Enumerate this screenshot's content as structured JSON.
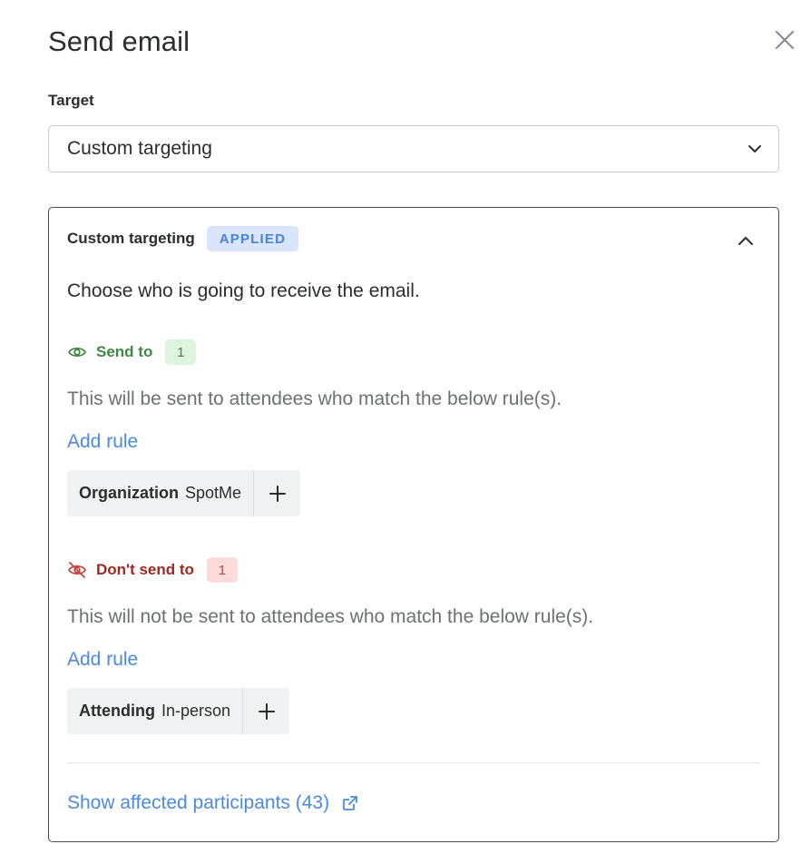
{
  "dialog": {
    "title": "Send email",
    "close_icon": "close-icon"
  },
  "target": {
    "label": "Target",
    "value": "Custom targeting"
  },
  "panel": {
    "title": "Custom targeting",
    "badge": "APPLIED",
    "intro": "Choose who is going to receive the email.",
    "send_to": {
      "label": "Send to",
      "count": "1",
      "description": "This will be sent to attendees who match the below rule(s).",
      "add_rule": "Add rule",
      "rule": {
        "key": "Organization",
        "value": "SpotMe"
      },
      "color": "#3f8a43"
    },
    "dont_send_to": {
      "label": "Don't send to",
      "count": "1",
      "description": "This will not be sent to attendees who match the below rule(s).",
      "add_rule": "Add rule",
      "rule": {
        "key": "Attending",
        "value": "In-person"
      },
      "color": "#a3271f"
    },
    "show_affected": "Show affected participants (43)"
  },
  "colors": {
    "link": "#4a8ae3",
    "applied_badge_bg": "#d8e5fb",
    "applied_badge_text": "#4a82dd"
  }
}
